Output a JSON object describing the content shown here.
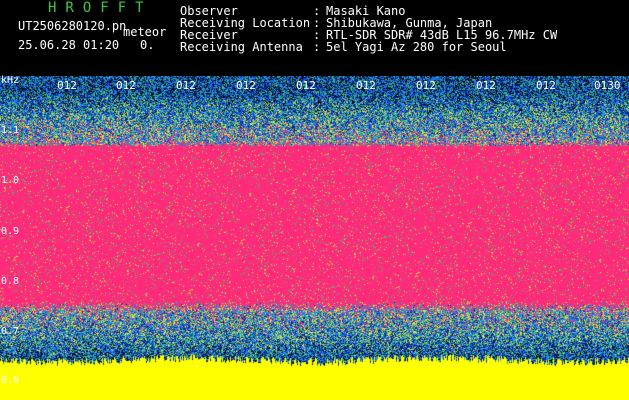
{
  "header": {
    "app_title": "HROFFT",
    "filename": "UT2506280120.pn",
    "mode": "meteor",
    "timestamp": "25.06.28 01:20",
    "count": "0."
  },
  "info": [
    {
      "label": "Observer",
      "value": "Masaki Kano"
    },
    {
      "label": "Receiving Location",
      "value": "Shibukawa, Gunma, Japan"
    },
    {
      "label": "Receiver",
      "value": "RTL-SDR SDR# 43dB L15 96.7MHz CW"
    },
    {
      "label": "Receiving Antenna",
      "value": "5el Yagi Az 280 for Seoul"
    }
  ],
  "colon": ":",
  "spectrogram": {
    "unit": "kHz",
    "y_ticks": [
      "1.1",
      "1.0",
      "0.9",
      "0.8",
      "0.7",
      "0.6"
    ],
    "time_labels": [
      "012",
      "012",
      "012",
      "012",
      "012",
      "012",
      "012",
      "012",
      "012",
      "0130"
    ],
    "colors": {
      "background": "#000000",
      "noise_dark": "#0a2a8c",
      "noise_mid": "#1e78ff",
      "noise_green": "#3cc86e",
      "noise_yellow": "#f0e040",
      "signal": "#ff2a7a",
      "floor": "#ffff00"
    }
  }
}
